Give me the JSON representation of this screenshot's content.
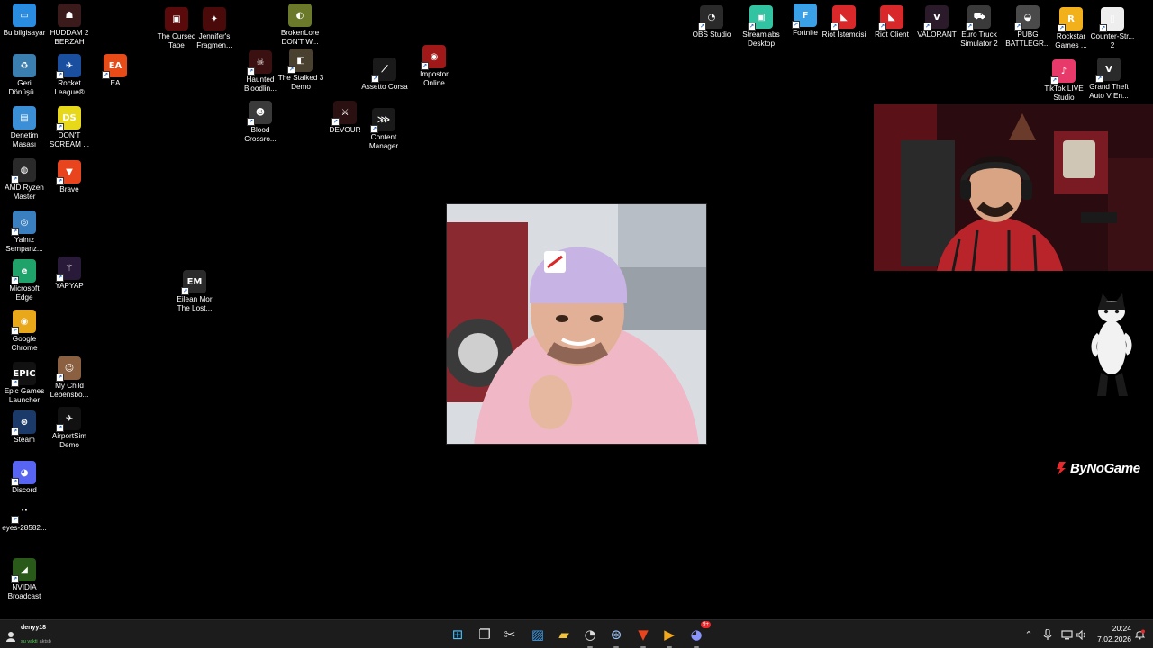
{
  "desktop": {
    "icons": [
      {
        "label": "Bu bilgisayar",
        "color": "#2a8ce0",
        "glyph": "▭"
      },
      {
        "label": "HUDDAM 2\nBERZAH",
        "color": "#3a1a1a",
        "glyph": "☗"
      },
      {
        "label": "The Cursed\nTape",
        "color": "#5a0a0a",
        "glyph": "▣"
      },
      {
        "label": "Jennifer's\nFragmen...",
        "color": "#4a0a0a",
        "glyph": "✦"
      },
      {
        "label": "BrokenLore\nDON'T W...",
        "color": "#6a7a2a",
        "glyph": "◐"
      },
      {
        "label": "Geri\nDönüşü...",
        "color": "#3b7fb0",
        "glyph": "♻"
      },
      {
        "label": "Rocket\nLeague®",
        "color": "#1a4fa0",
        "glyph": "✈"
      },
      {
        "label": "EA",
        "color": "#e84a18",
        "glyph": "EA"
      },
      {
        "label": "Haunted\nBloodlin...",
        "color": "#3a1010",
        "glyph": "☠"
      },
      {
        "label": "The Stalked 3\nDemo",
        "color": "#4a4030",
        "glyph": "◧"
      },
      {
        "label": "Assetto Corsa",
        "color": "#1a1a1a",
        "glyph": "⟋"
      },
      {
        "label": "Impostor\nOnline",
        "color": "#a01818",
        "glyph": "◉"
      },
      {
        "label": "Denetim\nMasası",
        "color": "#3a8fd6",
        "glyph": "▤"
      },
      {
        "label": "DON'T\nSCREAM ...",
        "color": "#e8d81a",
        "glyph": "DS"
      },
      {
        "label": "Blood\nCrossro...",
        "color": "#3a3a3a",
        "glyph": "☻"
      },
      {
        "label": "DEVOUR",
        "color": "#2a1010",
        "glyph": "⚔"
      },
      {
        "label": "Content\nManager",
        "color": "#1a1a1a",
        "glyph": "⋙"
      },
      {
        "label": "AMD Ryzen\nMaster",
        "color": "#2a2a2a",
        "glyph": "◍"
      },
      {
        "label": "Brave",
        "color": "#e8451e",
        "glyph": "▼"
      },
      {
        "label": "Yalnız\nSempanz...",
        "color": "#3a80c0",
        "glyph": "◎"
      },
      {
        "label": "Microsoft\nEdge",
        "color": "#1fa36a",
        "glyph": "e"
      },
      {
        "label": "YAPYAP",
        "color": "#2a1a3a",
        "glyph": "⚚"
      },
      {
        "label": "Eilean Mor\nThe Lost...",
        "color": "#2a2a2a",
        "glyph": "EM"
      },
      {
        "label": "Google\nChrome",
        "color": "#e8a81a",
        "glyph": "◉"
      },
      {
        "label": "Epic Games\nLauncher",
        "color": "#111111",
        "glyph": "EPIC"
      },
      {
        "label": "My Child\nLebensbo...",
        "color": "#8a6040",
        "glyph": "☺"
      },
      {
        "label": "Steam",
        "color": "#1b3a6a",
        "glyph": "⊛"
      },
      {
        "label": "AirportSim\nDemo",
        "color": "#111111",
        "glyph": "✈"
      },
      {
        "label": "Discord",
        "color": "#5865f2",
        "glyph": "◕"
      },
      {
        "label": "eyes-28582...",
        "color": "#000000",
        "glyph": "··"
      },
      {
        "label": "NVIDIA\nBroadcast",
        "color": "#2a5a1a",
        "glyph": "◢"
      },
      {
        "label": "OBS Studio",
        "color": "#2a2a2a",
        "glyph": "◔"
      },
      {
        "label": "Streamlabs\nDesktop",
        "color": "#31c3a2",
        "glyph": "▣"
      },
      {
        "label": "Fortnite",
        "color": "#3aa0e8",
        "glyph": "F"
      },
      {
        "label": "Riot İstemcisi",
        "color": "#d8282a",
        "glyph": "◣"
      },
      {
        "label": "Riot Client",
        "color": "#d8282a",
        "glyph": "◣"
      },
      {
        "label": "VALORANT",
        "color": "#2a1a2a",
        "glyph": "V"
      },
      {
        "label": "Euro Truck\nSimulator 2",
        "color": "#3a3a3a",
        "glyph": "⛟"
      },
      {
        "label": "PUBG\nBATTLEGR...",
        "color": "#4a4a4a",
        "glyph": "◒"
      },
      {
        "label": "Rockstar\nGames ...",
        "color": "#f2b01a",
        "glyph": "R"
      },
      {
        "label": "Counter-Str...\n2",
        "color": "#eeeeee",
        "glyph": "▯"
      },
      {
        "label": "TikTok LIVE\nStudio",
        "color": "#e83a6a",
        "glyph": "♪"
      },
      {
        "label": "Grand Theft\nAuto V En...",
        "color": "#2a2a2a",
        "glyph": "V"
      }
    ]
  },
  "overlay": {
    "logo_text": "ByNoGame"
  },
  "taskbar": {
    "weather_user": "denyy18",
    "weather_status": "su vakti",
    "weather_note": "aktsb",
    "clock_time": "20:24",
    "clock_date": "7.02.2026",
    "discord_badge": "9+",
    "apps": [
      {
        "name": "start-button",
        "glyph": "⊞",
        "color": "#4cc2ff"
      },
      {
        "name": "task-view-button",
        "glyph": "❐",
        "color": "#dddddd"
      },
      {
        "name": "snipping-tool-button",
        "glyph": "✂",
        "color": "#dddddd"
      },
      {
        "name": "photos-button",
        "glyph": "▨",
        "color": "#3a9ae8"
      },
      {
        "name": "file-explorer-button",
        "glyph": "▰",
        "color": "#f2c33a"
      },
      {
        "name": "obs-taskbar-button",
        "glyph": "◔",
        "color": "#dddddd"
      },
      {
        "name": "steam-taskbar-button",
        "glyph": "⊛",
        "color": "#9ec8ff"
      },
      {
        "name": "brave-taskbar-button",
        "glyph": "▼",
        "color": "#e8451e"
      },
      {
        "name": "media-player-button",
        "glyph": "▶",
        "color": "#f2a81a"
      },
      {
        "name": "discord-taskbar-button",
        "glyph": "◕",
        "color": "#8a94ff"
      }
    ]
  }
}
